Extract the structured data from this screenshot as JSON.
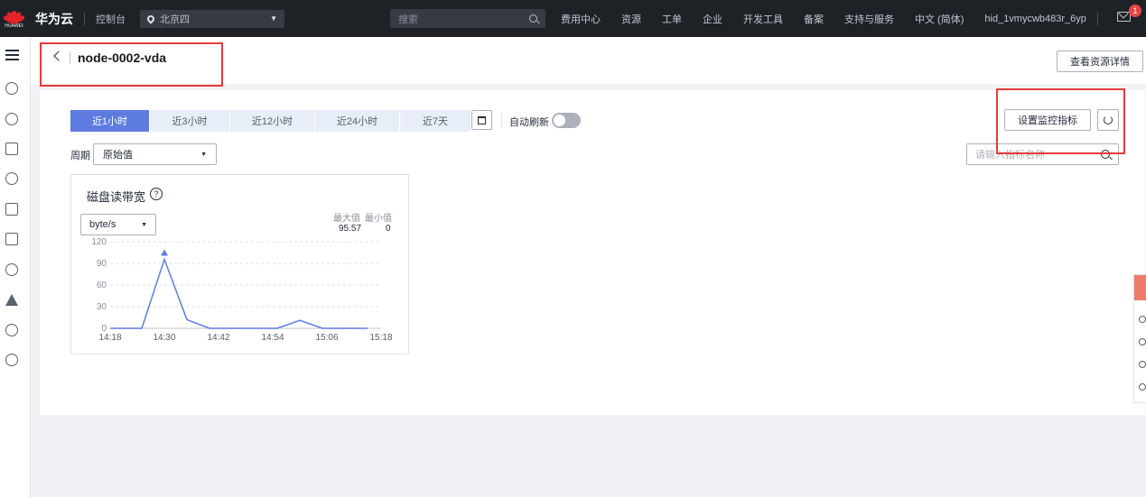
{
  "topbar": {
    "logo_text": "HUAWEI",
    "brand": "华为云",
    "console": "控制台",
    "region": "北京四",
    "search_placeholder": "搜索",
    "nav": [
      "费用中心",
      "资源",
      "工单",
      "企业",
      "开发工具",
      "备案",
      "支持与服务",
      "中文 (简体)",
      "hid_1vmycwb483r_6yp"
    ],
    "notification_count": "1"
  },
  "rail": {
    "icons": [
      "menu-icon",
      "cloud-server-icon",
      "cluster-icon",
      "network-icon",
      "storage-icon",
      "database-icon",
      "container-icon",
      "cloud-icon",
      "warning-icon",
      "globe-icon",
      "ip-icon"
    ]
  },
  "header": {
    "title": "node-0002-vda",
    "detail_button": "查看资源详情"
  },
  "toolbar": {
    "ranges": [
      "近1小时",
      "近3小时",
      "近12小时",
      "近24小时",
      "近7天"
    ],
    "active_range": "近1小时",
    "auto_refresh_label": "自动刷新",
    "auto_refresh_on": false,
    "set_metrics_button": "设置监控指标",
    "period_label": "周期",
    "period_value": "原始值",
    "metric_search_placeholder": "请输入指标名称"
  },
  "chart_card": {
    "title": "磁盘读带宽",
    "unit": "byte/s",
    "max_label": "最大值",
    "min_label": "最小值",
    "max_value": "95.57",
    "min_value": "0"
  },
  "chart_data": {
    "type": "line",
    "title": "磁盘读带宽",
    "ylabel": "byte/s",
    "ylim": [
      0,
      120
    ],
    "yticks": [
      0,
      30,
      60,
      90,
      120
    ],
    "xticks": [
      "14:18",
      "14:30",
      "14:42",
      "14:54",
      "15:06",
      "15:18"
    ],
    "series": [
      {
        "x": [
          "14:18",
          "14:22",
          "14:25",
          "14:30",
          "14:35",
          "14:40",
          "14:45",
          "14:50",
          "14:55",
          "15:00",
          "15:05",
          "15:10",
          "15:15"
        ],
        "values": [
          0,
          0,
          0,
          95.57,
          12,
          0,
          0,
          0,
          0,
          11,
          0,
          0,
          0
        ]
      }
    ],
    "max_marker": {
      "x": "14:30",
      "value": 95.57
    },
    "color": "#5e7ce0",
    "grid": true
  },
  "colors": {
    "accent": "#5e7ce0",
    "topbar_bg": "#1e2227",
    "highlight": "#e53b3b"
  }
}
